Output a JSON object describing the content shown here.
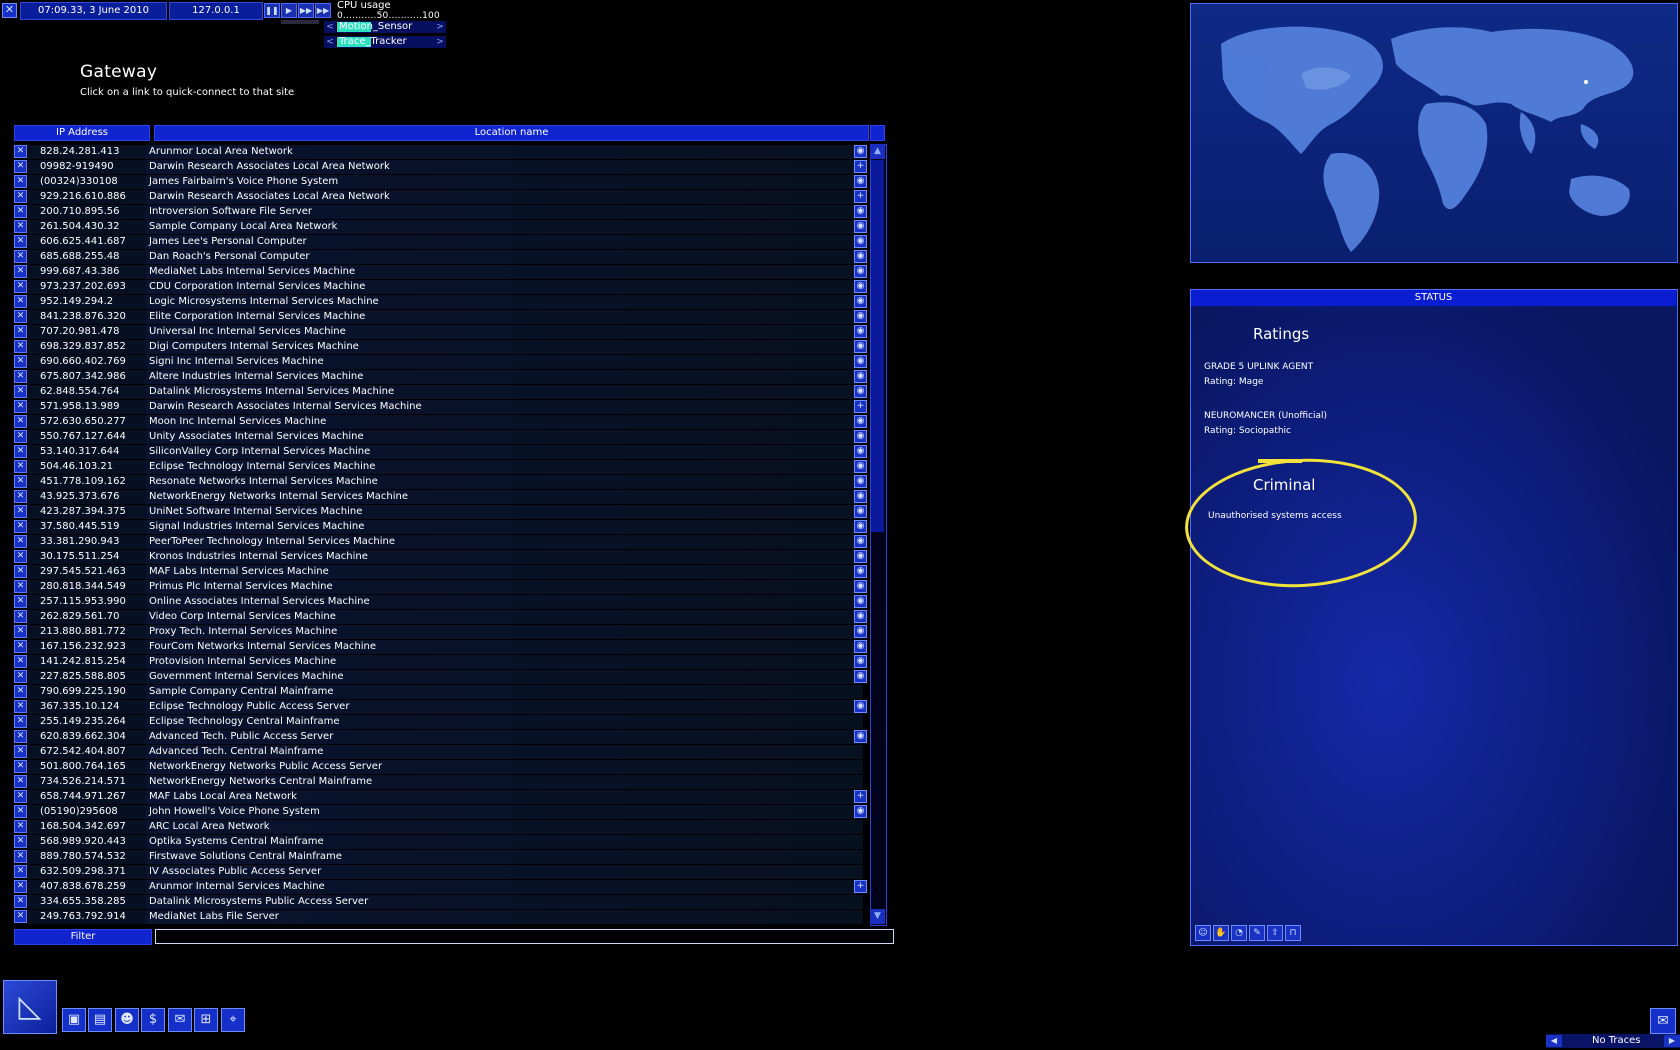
{
  "topbar": {
    "datetime": "07:09.33, 3 June 2010",
    "local_ip": "127.0.0.1",
    "cpu_label": "CPU usage",
    "cpu_scale": "0...........50...........100",
    "cpu_rows": [
      {
        "name": "Motion_Sensor",
        "load": 0.35
      },
      {
        "name": "Trace_Tracker",
        "load": 0.35
      }
    ],
    "speed_icons": [
      "pause-icon",
      "play-icon",
      "fast-icon",
      "fastest-icon"
    ]
  },
  "gateway": {
    "title": "Gateway",
    "subtitle": "Click on a link to quick-connect to that site",
    "col_ip": "IP Address",
    "col_location": "Location name",
    "filter_label": "Filter",
    "filter_value": "",
    "rows": [
      {
        "ip": "828.24.281.413",
        "loc": "Arunmor Local Area Network",
        "icon": "lan"
      },
      {
        "ip": "09982-919490",
        "loc": "Darwin Research Associates Local Area Network",
        "icon": "plus"
      },
      {
        "ip": "(00324)330108",
        "loc": "James Fairbairn's Voice Phone System",
        "icon": "dot"
      },
      {
        "ip": "929.216.610.886",
        "loc": "Darwin Research Associates Local Area Network",
        "icon": "plus"
      },
      {
        "ip": "200.710.895.56",
        "loc": "Introversion Software File Server",
        "icon": "dot"
      },
      {
        "ip": "261.504.430.32",
        "loc": "Sample Company Local Area Network",
        "icon": "dot"
      },
      {
        "ip": "606.625.441.687",
        "loc": "James Lee's Personal Computer",
        "icon": "dot"
      },
      {
        "ip": "685.688.255.48",
        "loc": "Dan Roach's Personal Computer",
        "icon": "dot"
      },
      {
        "ip": "999.687.43.386",
        "loc": "MediaNet Labs Internal Services Machine",
        "icon": "dot"
      },
      {
        "ip": "973.237.202.693",
        "loc": "CDU Corporation Internal Services Machine",
        "icon": "dot"
      },
      {
        "ip": "952.149.294.2",
        "loc": "Logic Microsystems Internal Services Machine",
        "icon": "dot"
      },
      {
        "ip": "841.238.876.320",
        "loc": "Elite Corporation Internal Services Machine",
        "icon": "dot"
      },
      {
        "ip": "707.20.981.478",
        "loc": "Universal Inc Internal Services Machine",
        "icon": "dot"
      },
      {
        "ip": "698.329.837.852",
        "loc": "Digi Computers Internal Services Machine",
        "icon": "dot"
      },
      {
        "ip": "690.660.402.769",
        "loc": "Signi Inc Internal Services Machine",
        "icon": "dot"
      },
      {
        "ip": "675.807.342.986",
        "loc": "Altere Industries Internal Services Machine",
        "icon": "dot"
      },
      {
        "ip": "62.848.554.764",
        "loc": "Datalink Microsystems Internal Services Machine",
        "icon": "dot"
      },
      {
        "ip": "571.958.13.989",
        "loc": "Darwin Research Associates Internal Services Machine",
        "icon": "plus"
      },
      {
        "ip": "572.630.650.277",
        "loc": "Moon Inc Internal Services Machine",
        "icon": "dot"
      },
      {
        "ip": "550.767.127.644",
        "loc": "Unity Associates Internal Services Machine",
        "icon": "dot"
      },
      {
        "ip": "53.140.317.644",
        "loc": "SiliconValley Corp Internal Services Machine",
        "icon": "dot"
      },
      {
        "ip": "504.46.103.21",
        "loc": "Eclipse Technology Internal Services Machine",
        "icon": "dot"
      },
      {
        "ip": "451.778.109.162",
        "loc": "Resonate Networks Internal Services Machine",
        "icon": "dot"
      },
      {
        "ip": "43.925.373.676",
        "loc": "NetworkEnergy Networks Internal Services Machine",
        "icon": "dot"
      },
      {
        "ip": "423.287.394.375",
        "loc": "UniNet Software Internal Services Machine",
        "icon": "dot"
      },
      {
        "ip": "37.580.445.519",
        "loc": "Signal Industries Internal Services Machine",
        "icon": "dot"
      },
      {
        "ip": "33.381.290.943",
        "loc": "PeerToPeer Technology Internal Services Machine",
        "icon": "dot"
      },
      {
        "ip": "30.175.511.254",
        "loc": "Kronos Industries Internal Services Machine",
        "icon": "dot"
      },
      {
        "ip": "297.545.521.463",
        "loc": "MAF Labs Internal Services Machine",
        "icon": "dot"
      },
      {
        "ip": "280.818.344.549",
        "loc": "Primus Plc Internal Services Machine",
        "icon": "dot"
      },
      {
        "ip": "257.115.953.990",
        "loc": "Online Associates Internal Services Machine",
        "icon": "dot"
      },
      {
        "ip": "262.829.561.70",
        "loc": "Video Corp Internal Services Machine",
        "icon": "dot"
      },
      {
        "ip": "213.880.881.772",
        "loc": "Proxy Tech. Internal Services Machine",
        "icon": "dot"
      },
      {
        "ip": "167.156.232.923",
        "loc": "FourCom Networks Internal Services Machine",
        "icon": "dot"
      },
      {
        "ip": "141.242.815.254",
        "loc": "Protovision Internal Services Machine",
        "icon": "dot"
      },
      {
        "ip": "227.825.588.805",
        "loc": "Government Internal Services Machine",
        "icon": "dot"
      },
      {
        "ip": "790.699.225.190",
        "loc": "Sample Company Central Mainframe",
        "icon": ""
      },
      {
        "ip": "367.335.10.124",
        "loc": "Eclipse Technology Public Access Server",
        "icon": "dot"
      },
      {
        "ip": "255.149.235.264",
        "loc": "Eclipse Technology Central Mainframe",
        "icon": ""
      },
      {
        "ip": "620.839.662.304",
        "loc": "Advanced Tech. Public Access Server",
        "icon": "dot"
      },
      {
        "ip": "672.542.404.807",
        "loc": "Advanced Tech. Central Mainframe",
        "icon": ""
      },
      {
        "ip": "501.800.764.165",
        "loc": "NetworkEnergy Networks Public Access Server",
        "icon": ""
      },
      {
        "ip": "734.526.214.571",
        "loc": "NetworkEnergy Networks Central Mainframe",
        "icon": ""
      },
      {
        "ip": "658.744.971.267",
        "loc": "MAF Labs Local Area Network",
        "icon": "plus"
      },
      {
        "ip": "(05190)295608",
        "loc": "John Howell's Voice Phone System",
        "icon": "dot"
      },
      {
        "ip": "168.504.342.697",
        "loc": "ARC Local Area Network",
        "icon": ""
      },
      {
        "ip": "568.989.920.443",
        "loc": "Optika Systems Central Mainframe",
        "icon": ""
      },
      {
        "ip": "889.780.574.532",
        "loc": "Firstwave Solutions Central Mainframe",
        "icon": ""
      },
      {
        "ip": "632.509.298.371",
        "loc": "IV Associates Public Access Server",
        "icon": ""
      },
      {
        "ip": "407.838.678.259",
        "loc": "Arunmor Internal Services Machine",
        "icon": "plus"
      },
      {
        "ip": "334.655.358.285",
        "loc": "Datalink Microsystems Public Access Server",
        "icon": ""
      },
      {
        "ip": "249.763.792.914",
        "loc": "MediaNet Labs File Server",
        "icon": ""
      }
    ]
  },
  "status": {
    "header": "STATUS",
    "ratings_title": "Ratings",
    "uplink_grade": "GRADE 5 UPLINK AGENT",
    "uplink_rating": "Rating: Mage",
    "neuro_title": "NEUROMANCER (Unofficial)",
    "neuro_rating": "Rating: Sociopathic",
    "criminal_title": "Criminal",
    "criminal_text": "Unauthorised systems access",
    "highlight_color": "#f2e23c",
    "bottom_icons": [
      "person-icon",
      "hand-icon",
      "dial-icon",
      "pen-icon",
      "arrow-up-icon",
      "lock-icon"
    ]
  },
  "bottom": {
    "traces": "No Traces",
    "dock_icons": [
      "hardware-icon",
      "memory-icon",
      "people-icon",
      "finance-icon",
      "mail-icon",
      "network-icon",
      "map-icon"
    ]
  }
}
